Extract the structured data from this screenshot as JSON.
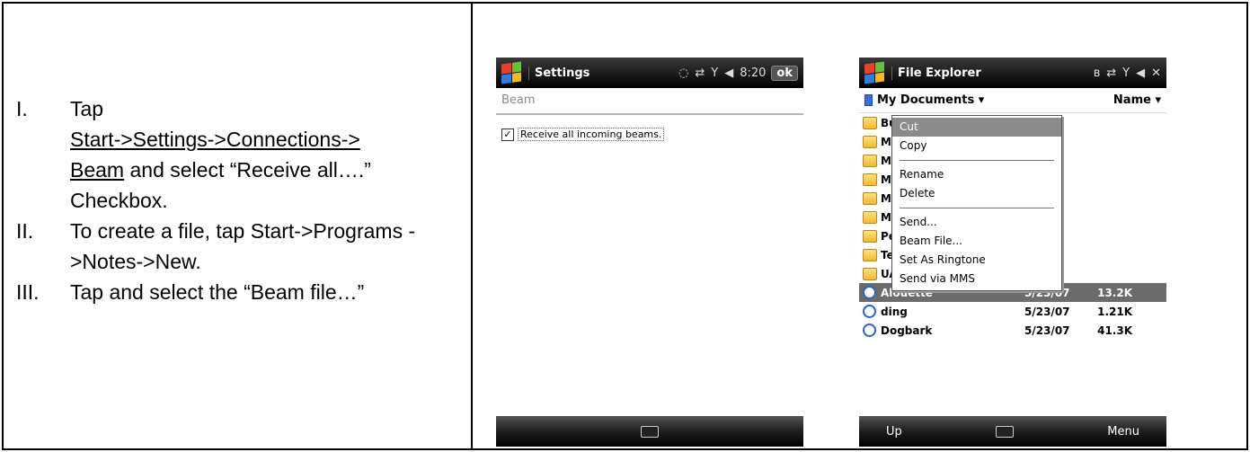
{
  "instructions": [
    {
      "num": "I.",
      "parts": [
        {
          "text": "Tap",
          "u": false
        },
        {
          "text": "Start->Settings->Connections->",
          "u": true
        },
        {
          "text": "Beam",
          "u": true
        },
        {
          "text": " and select “Receive all….” Checkbox.",
          "u": false
        }
      ]
    },
    {
      "num": "II.",
      "parts": [
        {
          "text": "To create a file, tap Start->Programs ->Notes->New.",
          "u": false
        }
      ]
    },
    {
      "num": "III.",
      "parts": [
        {
          "text": "Tap and select the “Beam file…”",
          "u": false
        }
      ]
    }
  ],
  "settings_screen": {
    "title": "Settings",
    "time": "8:20",
    "ok_label": "ok",
    "page_header": "Beam",
    "checkbox_label": "Receive all incoming beams.",
    "checkbox_checked": true
  },
  "explorer_screen": {
    "title": "File Explorer",
    "location": "My Documents ▾",
    "sort": "Name ▾",
    "folders": [
      "Bu",
      "My",
      "My",
      "My",
      "My",
      "My",
      "Pe",
      "Te",
      "UA"
    ],
    "files": [
      {
        "name": "Alouette",
        "date": "5/23/07",
        "size": "13.2K",
        "selected": true
      },
      {
        "name": "ding",
        "date": "5/23/07",
        "size": "1.21K",
        "selected": false
      },
      {
        "name": "Dogbark",
        "date": "5/23/07",
        "size": "41.3K",
        "selected": false
      }
    ],
    "context_menu": {
      "group1": [
        "Cut",
        "Copy"
      ],
      "group2": [
        "Rename",
        "Delete"
      ],
      "group3": [
        "Send...",
        "Beam File...",
        "Set As Ringtone",
        "Send via MMS"
      ]
    },
    "softkeys": {
      "left": "Up",
      "right": "Menu"
    }
  }
}
